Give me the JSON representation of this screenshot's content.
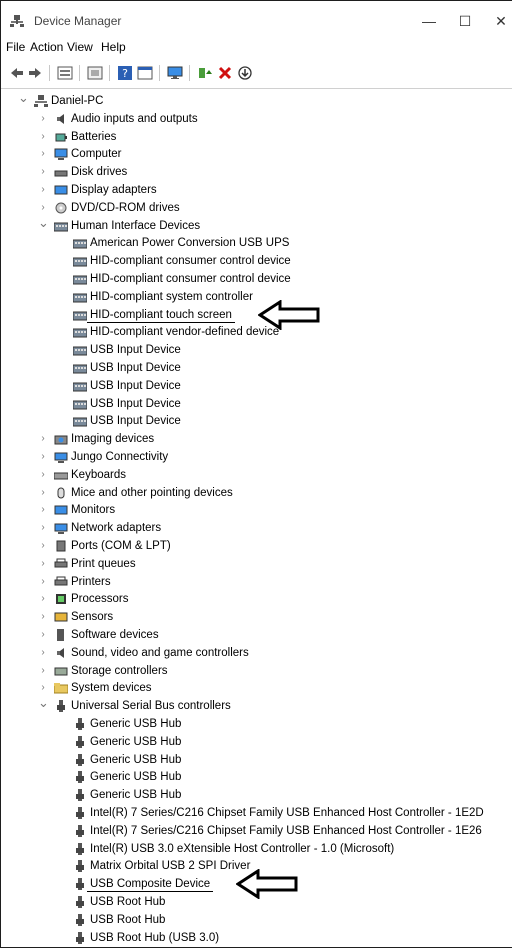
{
  "window": {
    "title": "Device Manager"
  },
  "menu": [
    "File",
    "Action",
    "View",
    "Help"
  ],
  "toolbar": {
    "icons": [
      "back-icon",
      "forward-icon",
      "properties-icon",
      "show-hidden-icon",
      "help-icon",
      "view-icon",
      "monitor-icon",
      "update-driver-icon",
      "uninstall-icon",
      "scan-hardware-icon"
    ]
  },
  "tree": {
    "root": "Daniel-PC",
    "categories": [
      {
        "label": "Audio inputs and outputs",
        "icon": "speaker-icon",
        "expanded": false
      },
      {
        "label": "Batteries",
        "icon": "battery-icon",
        "expanded": false
      },
      {
        "label": "Computer",
        "icon": "computer-icon",
        "expanded": false
      },
      {
        "label": "Disk drives",
        "icon": "disk-icon",
        "expanded": false
      },
      {
        "label": "Display adapters",
        "icon": "display-adapter-icon",
        "expanded": false
      },
      {
        "label": "DVD/CD-ROM drives",
        "icon": "dvd-icon",
        "expanded": false
      },
      {
        "label": "Human Interface Devices",
        "icon": "hid-icon",
        "expanded": true,
        "children": [
          "American Power Conversion USB UPS",
          "HID-compliant consumer control device",
          "HID-compliant consumer control device",
          "HID-compliant system controller",
          "HID-compliant touch screen",
          "HID-compliant vendor-defined device",
          "USB Input Device",
          "USB Input Device",
          "USB Input Device",
          "USB Input Device",
          "USB Input Device"
        ]
      },
      {
        "label": "Imaging devices",
        "icon": "camera-icon",
        "expanded": false
      },
      {
        "label": "Jungo Connectivity",
        "icon": "network-icon",
        "expanded": false
      },
      {
        "label": "Keyboards",
        "icon": "keyboard-icon",
        "expanded": false
      },
      {
        "label": "Mice and other pointing devices",
        "icon": "mouse-icon",
        "expanded": false
      },
      {
        "label": "Monitors",
        "icon": "monitor-icon",
        "expanded": false
      },
      {
        "label": "Network adapters",
        "icon": "network-adapter-icon",
        "expanded": false
      },
      {
        "label": "Ports (COM & LPT)",
        "icon": "port-icon",
        "expanded": false
      },
      {
        "label": "Print queues",
        "icon": "printer-icon",
        "expanded": false
      },
      {
        "label": "Printers",
        "icon": "printer-icon",
        "expanded": false
      },
      {
        "label": "Processors",
        "icon": "processor-icon",
        "expanded": false
      },
      {
        "label": "Sensors",
        "icon": "sensor-icon",
        "expanded": false
      },
      {
        "label": "Software devices",
        "icon": "software-icon",
        "expanded": false
      },
      {
        "label": "Sound, video and game controllers",
        "icon": "speaker-icon",
        "expanded": false
      },
      {
        "label": "Storage controllers",
        "icon": "storage-icon",
        "expanded": false
      },
      {
        "label": "System devices",
        "icon": "system-folder-icon",
        "expanded": false
      },
      {
        "label": "Universal Serial Bus controllers",
        "icon": "usb-icon",
        "expanded": true,
        "children": [
          "Generic USB Hub",
          "Generic USB Hub",
          "Generic USB Hub",
          "Generic USB Hub",
          "Generic USB Hub",
          "Intel(R) 7 Series/C216 Chipset Family USB Enhanced Host Controller - 1E2D",
          "Intel(R) 7 Series/C216 Chipset Family USB Enhanced Host Controller - 1E26",
          "Intel(R) USB 3.0 eXtensible Host Controller - 1.0 (Microsoft)",
          "Matrix Orbital USB 2 SPI Driver",
          "USB Composite Device",
          "USB Root Hub",
          "USB Root Hub",
          "USB Root Hub (USB 3.0)"
        ]
      }
    ]
  },
  "annotations": {
    "highlighted": [
      "HID-compliant touch screen",
      "USB Composite Device"
    ]
  }
}
